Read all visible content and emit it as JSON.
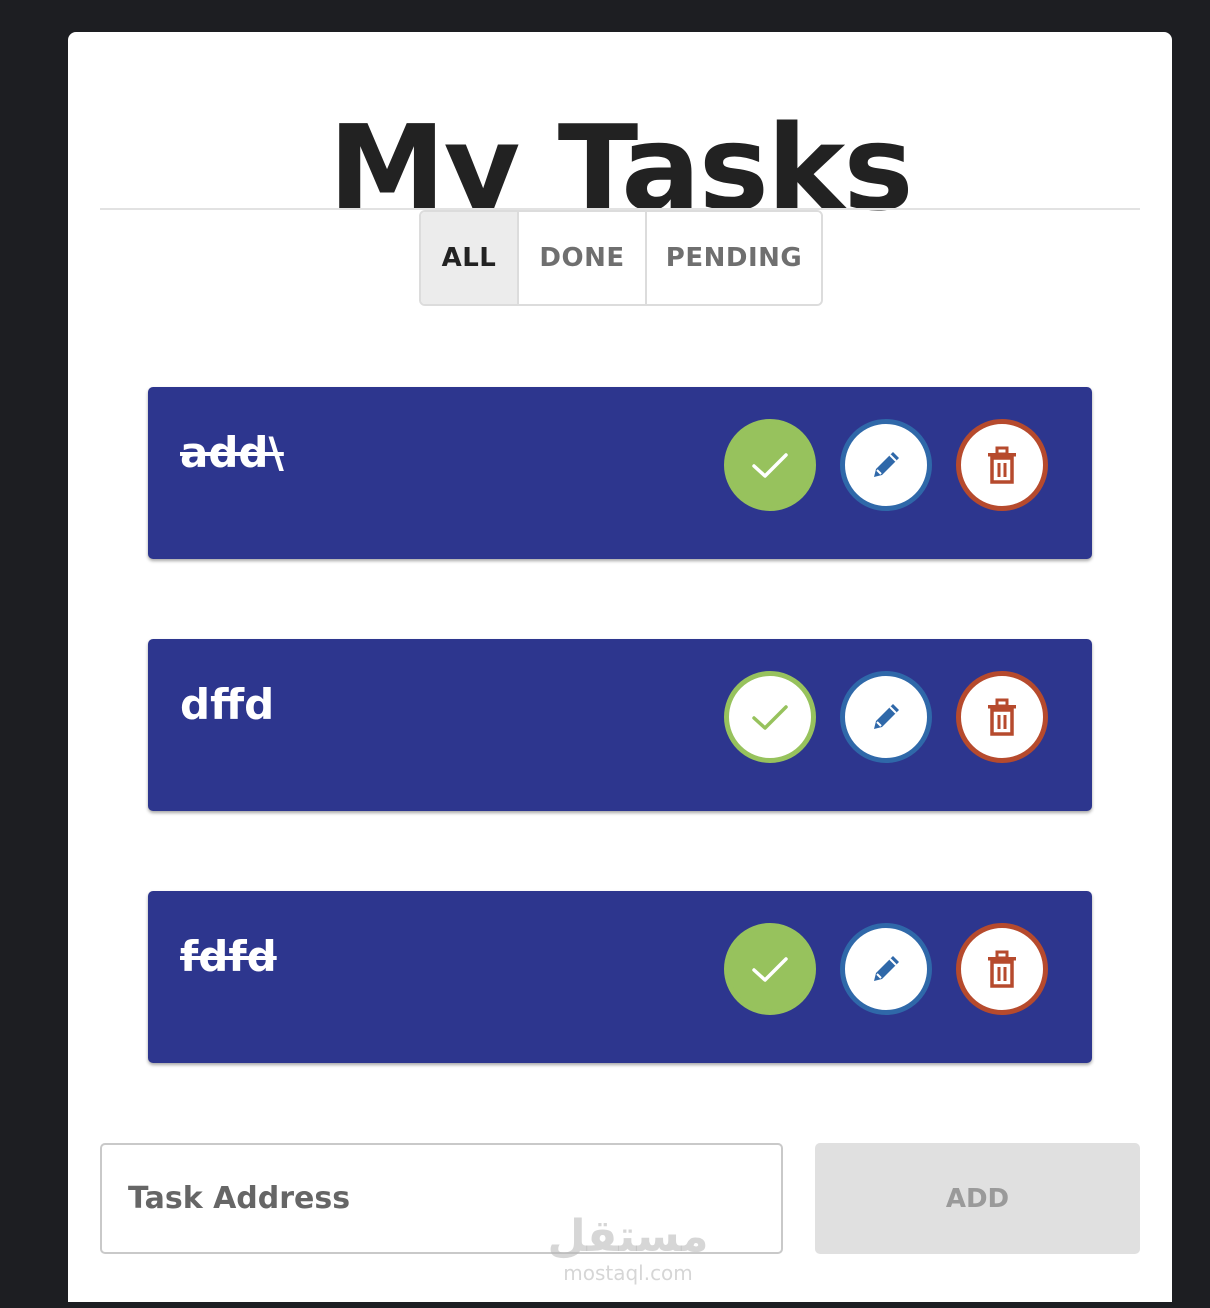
{
  "colors": {
    "page_background": "#1d1e22",
    "card_background": "#ffffff",
    "task_background": "#2d368e",
    "check_green": "#97c25d",
    "edit_blue": "#2f68a9",
    "delete_red": "#b64a2d",
    "add_button_bg": "#e0e0e0"
  },
  "header": {
    "title": "My Tasks"
  },
  "filters": {
    "all": "ALL",
    "done": "DONE",
    "pending": "PENDING",
    "active": "ALL"
  },
  "tasks": [
    {
      "text": "add\\",
      "done": true
    },
    {
      "text": "dffd",
      "done": false
    },
    {
      "text": "fdfd",
      "done": true
    }
  ],
  "icons": {
    "check": "check-icon",
    "edit": "pencil-icon",
    "delete": "trash-icon"
  },
  "form": {
    "input_placeholder": "Task Address",
    "input_value": "",
    "add_label": "ADD"
  },
  "watermark": {
    "arabic": "مستقل",
    "latin": "mostaql.com"
  }
}
